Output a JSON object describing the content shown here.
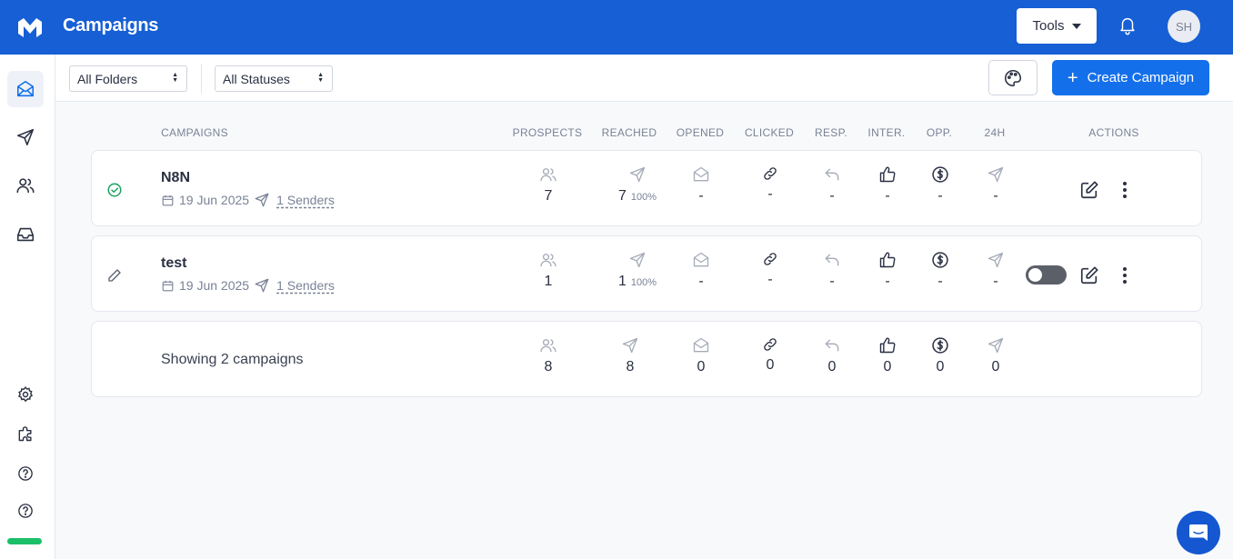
{
  "header": {
    "title": "Campaigns",
    "tools_label": "Tools",
    "avatar_initials": "SH",
    "brand_color": "#165fd5"
  },
  "filters": {
    "folder_select": "All Folders",
    "status_select": "All Statuses",
    "create_label": "Create Campaign"
  },
  "columns": {
    "campaigns": "CAMPAIGNS",
    "prospects": "PROSPECTS",
    "reached": "REACHED",
    "opened": "OPENED",
    "clicked": "CLICKED",
    "resp": "RESP.",
    "inter": "INTER.",
    "opp": "OPP.",
    "h24": "24H",
    "actions": "ACTIONS"
  },
  "campaigns": [
    {
      "name": "N8N",
      "date": "19 Jun 2025",
      "senders": "1 Senders",
      "status": "active",
      "prospects": "7",
      "reached": "7",
      "reached_pct": "100%",
      "opened": "-",
      "clicked": "-",
      "resp": "-",
      "inter": "-",
      "opp": "-",
      "h24": "-"
    },
    {
      "name": "test",
      "date": "19 Jun 2025",
      "senders": "1 Senders",
      "status": "draft",
      "prospects": "1",
      "reached": "1",
      "reached_pct": "100%",
      "opened": "-",
      "clicked": "-",
      "resp": "-",
      "inter": "-",
      "opp": "-",
      "h24": "-"
    }
  ],
  "summary": {
    "text": "Showing 2 campaigns",
    "prospects": "8",
    "reached": "8",
    "opened": "0",
    "clicked": "0",
    "resp": "0",
    "inter": "0",
    "opp": "0",
    "h24": "0"
  }
}
